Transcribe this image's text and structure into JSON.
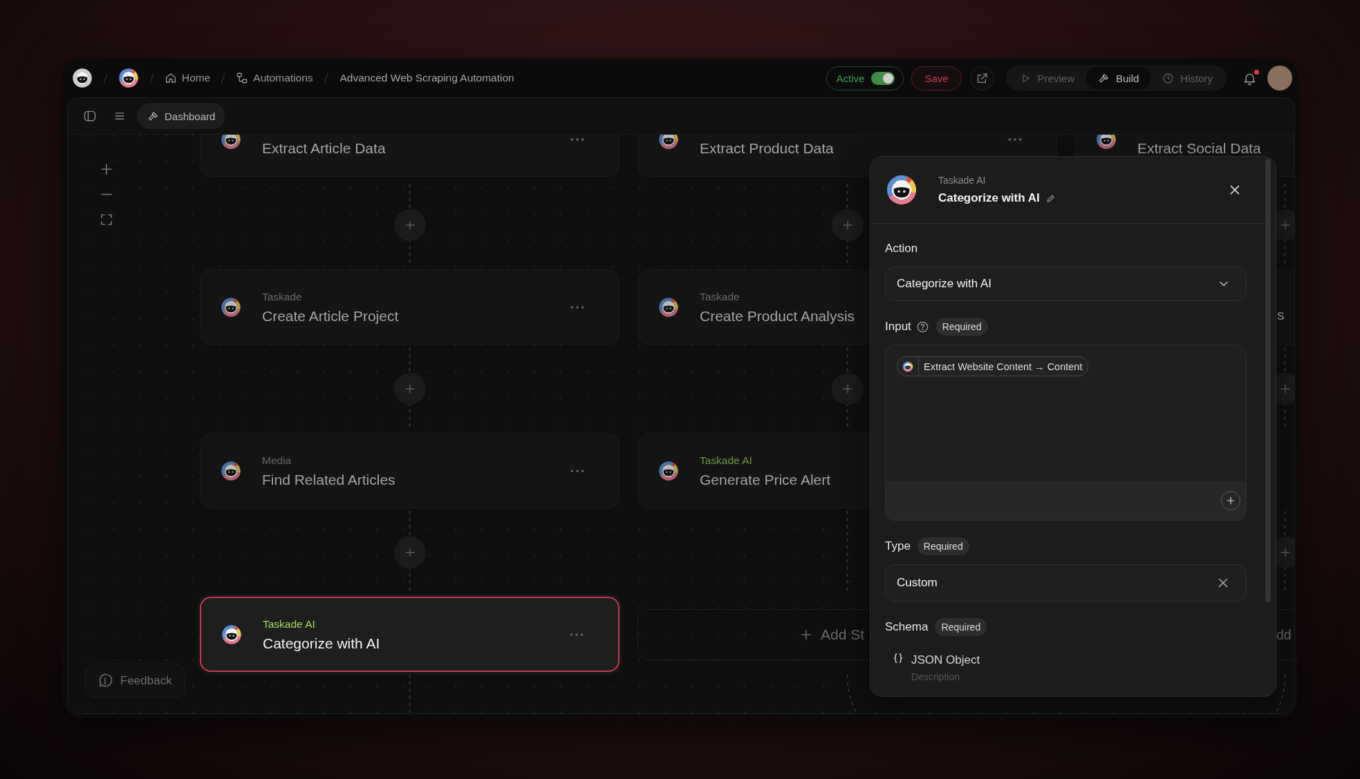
{
  "app_bar": {
    "breadcrumbs": [
      {
        "label": "Home"
      },
      {
        "label": "Automations"
      },
      {
        "label": "Advanced Web Scraping Automation"
      }
    ],
    "status": {
      "label": "Active",
      "on": true
    },
    "save_button": "Save",
    "modes": [
      {
        "label": "Preview",
        "selected": false
      },
      {
        "label": "Build",
        "selected": true
      },
      {
        "label": "History",
        "selected": false
      }
    ],
    "notifications": {
      "unread": true
    }
  },
  "toolbar": {
    "dashboard_tab": "Dashboard"
  },
  "canvas": {
    "columns": [
      {
        "steps": [
          {
            "kind": "step",
            "title": "Extract Article Data",
            "selected": false
          },
          {
            "kind": "step",
            "provider": "Taskade",
            "color": "#676767",
            "title": "Create Article Project",
            "selected": false
          },
          {
            "kind": "step",
            "provider": "Media",
            "color": "#676767",
            "title": "Find Related Articles",
            "selected": false
          },
          {
            "kind": "step",
            "provider": "Taskade AI",
            "color": "#a6dc5e",
            "title": "Categorize with AI",
            "selected": true
          }
        ]
      },
      {
        "steps": [
          {
            "kind": "step",
            "title": "Extract Product Data",
            "selected": false
          },
          {
            "kind": "step",
            "provider": "Taskade",
            "color": "#676767",
            "title": "Create Product Analysis",
            "selected": false
          },
          {
            "kind": "step",
            "provider": "Taskade AI",
            "color": "#6f9840",
            "title": "Generate Price Alert",
            "selected": false
          },
          {
            "kind": "add",
            "label": "Add St"
          }
        ]
      },
      {
        "steps": [
          {
            "kind": "step",
            "title": "Extract Social Data",
            "selected": false
          },
          {
            "kind": "title_fragment",
            "text": "s"
          },
          {
            "kind": "covered"
          },
          {
            "kind": "add_fragment",
            "text": "dd"
          }
        ]
      }
    ],
    "feedback_label": "Feedback"
  },
  "panel": {
    "provider": "Taskade AI",
    "title": "Categorize with AI",
    "fields": [
      {
        "kind": "select",
        "label": "Action",
        "value": "Categorize with AI"
      },
      {
        "kind": "mapping",
        "label": "Input",
        "help": true,
        "badge": "Required",
        "chips": [
          {
            "text": "Extract Website Content → Content"
          }
        ]
      },
      {
        "kind": "clearable",
        "label": "Type",
        "badge": "Required",
        "value": "Custom"
      },
      {
        "kind": "schema",
        "label": "Schema",
        "badge": "Required",
        "name": "JSON Object",
        "placeholder": "Description"
      }
    ]
  }
}
